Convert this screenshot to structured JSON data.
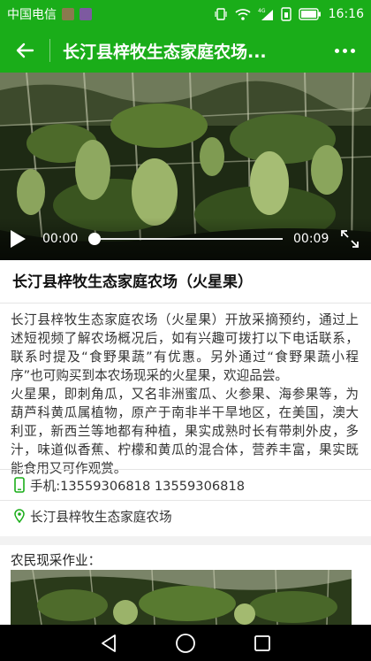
{
  "status_bar": {
    "carrier": "中国电信",
    "network": "4G",
    "time": "16:16",
    "icons": [
      "wifi-icon",
      "signal-icon",
      "sim-icon",
      "battery-icon"
    ]
  },
  "app_bar": {
    "title": "长汀县梓牧生态家庭农场...",
    "back_icon": "arrow-left-icon",
    "more_icon": "more-dots-icon",
    "color": "#1aad19"
  },
  "video": {
    "current_time": "00:00",
    "duration": "00:09",
    "progress": 0.0
  },
  "article": {
    "title": "长汀县梓牧生态家庭农场（火星果）",
    "paragraphs": [
      "长汀县梓牧生态家庭农场（火星果）开放采摘预约，通过上述短视频了解农场概况后，如有兴趣可拨打以下电话联系，联系时提及“食野果蔬”有优惠。另外通过“食野果蔬小程序”也可购买到本农场现采的火星果，欢迎品尝。",
      "火星果，即刺角瓜，又名非洲蜜瓜、火参果、海参果等，为葫芦科黄瓜属植物，原产于南非半干旱地区，在美国，澳大利亚，新西兰等地都有种植，果实成熟时长有带刺外皮，多汁，味道似香蕉、柠檬和黄瓜的混合体，营养丰富，果实既能食用又可作观赏。"
    ]
  },
  "contact": {
    "phone": "手机:13559306818 13559306818",
    "location": "长汀县梓牧生态家庭农场",
    "accent": "#1aad19"
  },
  "section": {
    "label": "农民现采作业："
  },
  "nav_bar": {
    "icons": [
      "back-triangle-icon",
      "home-circle-icon",
      "recents-square-icon"
    ]
  }
}
